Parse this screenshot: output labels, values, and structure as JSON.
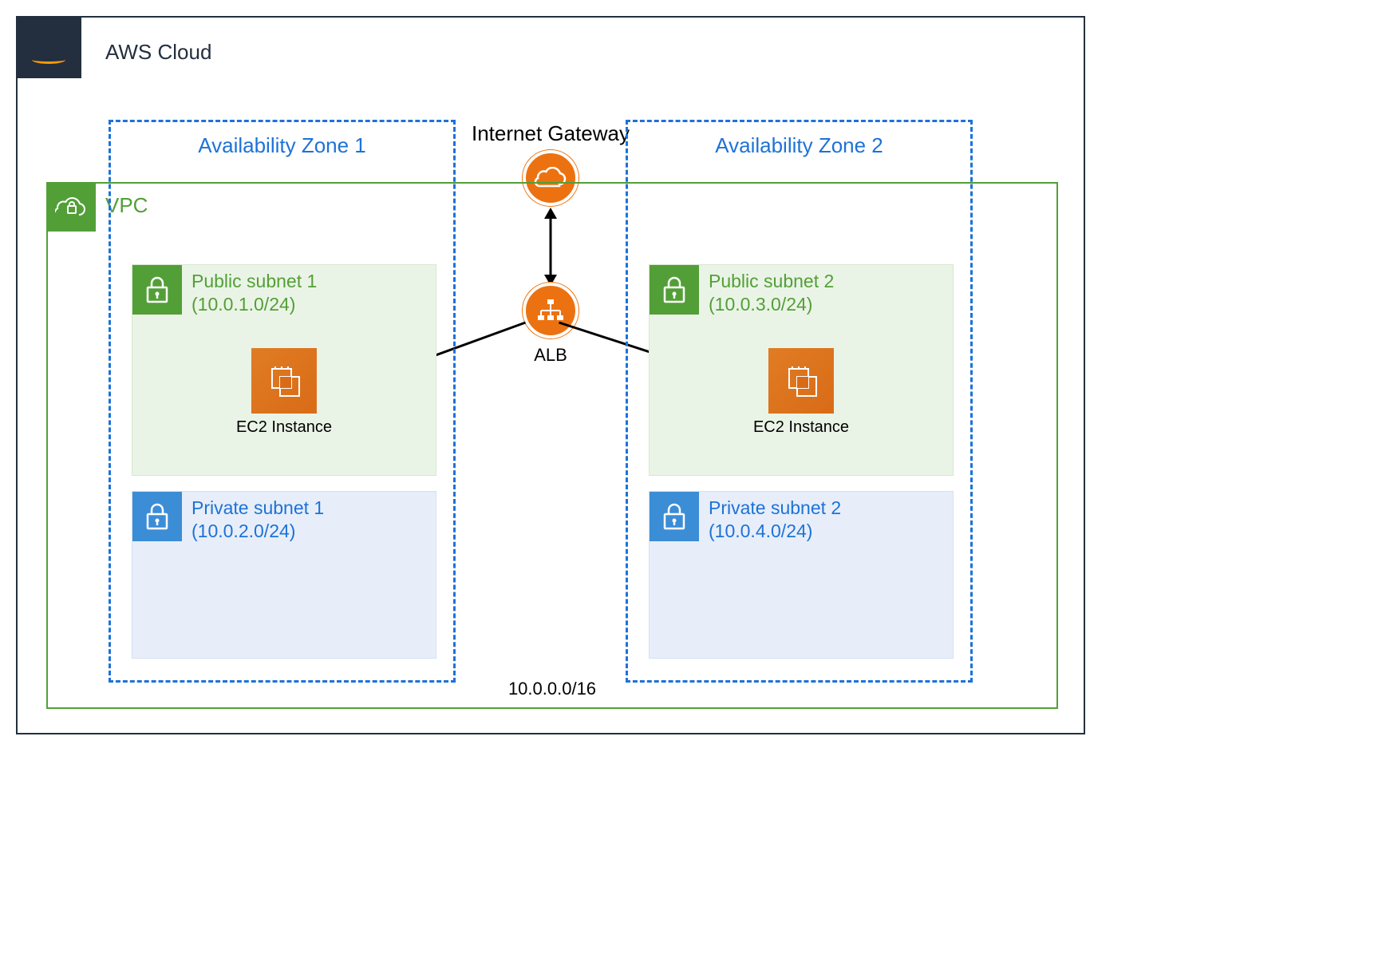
{
  "cloud": {
    "label": "AWS Cloud",
    "logo": "aws"
  },
  "vpc": {
    "label": "VPC",
    "cidr": "10.0.0.0/16"
  },
  "internet_gateway": {
    "label": "Internet Gateway"
  },
  "alb": {
    "label": "ALB"
  },
  "availability_zones": [
    {
      "label": "Availability Zone 1",
      "public_subnet": {
        "name": "Public subnet 1",
        "cidr": "10.0.1.0/24",
        "ec2_label": "EC2 Instance"
      },
      "private_subnet": {
        "name": "Private subnet 1",
        "cidr": "10.0.2.0/24"
      }
    },
    {
      "label": "Availability Zone 2",
      "public_subnet": {
        "name": "Public subnet 2",
        "cidr": "10.0.3.0/24",
        "ec2_label": "EC2 Instance"
      },
      "private_subnet": {
        "name": "Private subnet 2",
        "cidr": "10.0.4.0/24"
      }
    }
  ],
  "connections": [
    {
      "from": "internet_gateway",
      "to": "alb",
      "bidirectional": true
    },
    {
      "from": "alb",
      "to": "az1.public_subnet.ec2",
      "bidirectional": false
    },
    {
      "from": "alb",
      "to": "az2.public_subnet.ec2",
      "bidirectional": false
    }
  ],
  "colors": {
    "aws_dark": "#232f3e",
    "aws_orange": "#ec7211",
    "vpc_green": "#539f37",
    "az_blue": "#1d72d8",
    "private_blue": "#3b8dd6"
  }
}
